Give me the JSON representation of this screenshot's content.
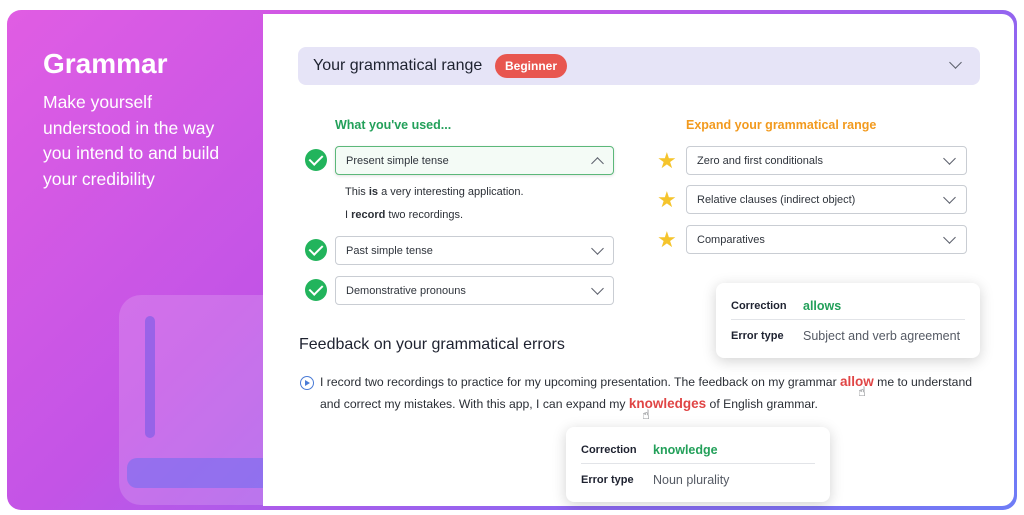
{
  "left": {
    "title": "Grammar",
    "description": "Make yourself understood in the way you intend to and build your credibility"
  },
  "range": {
    "title": "Your grammatical range",
    "level_badge": "Beginner"
  },
  "used": {
    "title": "What you've used...",
    "items": [
      {
        "label": "Present simple tense",
        "expanded": true
      },
      {
        "label": "Past simple tense",
        "expanded": false
      },
      {
        "label": "Demonstrative pronouns",
        "expanded": false
      }
    ],
    "examples": [
      {
        "before": "This ",
        "bold": "is",
        "after": " a very interesting application."
      },
      {
        "before": "I ",
        "bold": "record",
        "after": " two recordings."
      }
    ]
  },
  "expand": {
    "title": "Expand your grammatical range",
    "items": [
      {
        "label": "Zero and first conditionals"
      },
      {
        "label": "Relative clauses (indirect object)"
      },
      {
        "label": "Comparatives"
      }
    ]
  },
  "tooltip_top": {
    "correction_label": "Correction",
    "correction_value": "allows",
    "error_type_label": "Error type",
    "error_type_value": "Subject and verb agreement"
  },
  "feedback": {
    "title": "Feedback on your grammatical errors",
    "line1_before": "I record two recordings to practice for my upcoming presentation. The feedback on my grammar ",
    "line1_error": "allow",
    "line1_after": " me to understand",
    "line2_before": "and correct my mistakes. With this app, I can expand my ",
    "line2_error": "knowledges",
    "line2_after": " of English grammar."
  },
  "tooltip_bottom": {
    "correction_label": "Correction",
    "correction_value": "knowledge",
    "error_type_label": "Error type",
    "error_type_value": "Noun plurality"
  },
  "colors": {
    "badge": "#e8564f",
    "used_accent": "#23a05a",
    "expand_accent": "#f29a1e",
    "error": "#e04545"
  }
}
